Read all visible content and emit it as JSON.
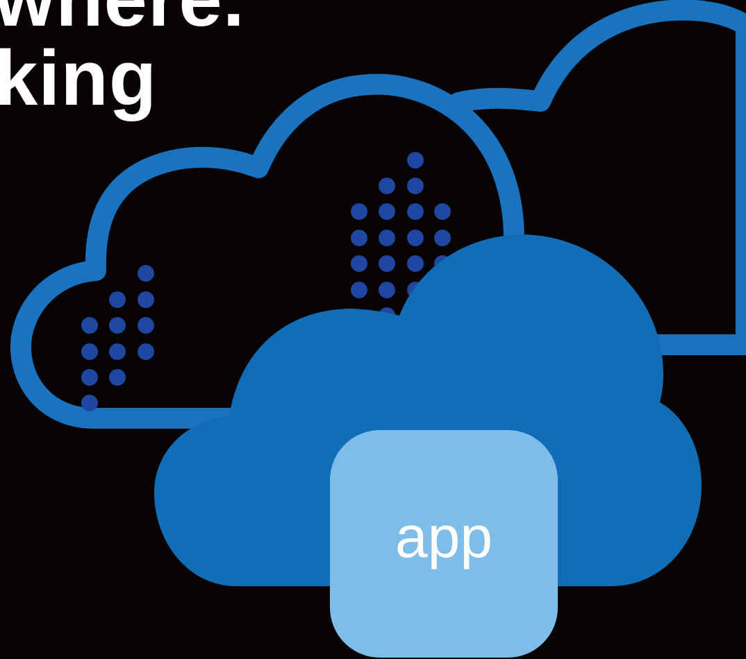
{
  "headline": {
    "line1": "where.",
    "line2": "king"
  },
  "app_tile": {
    "label": "app"
  },
  "icons": {
    "back_cloud": "cloud-outline-icon",
    "mid_cloud": "cloud-outline-icon",
    "front_cloud": "cloud-filled-icon",
    "dots": "dot-pattern"
  },
  "colors": {
    "background": "#070303",
    "cloud_outline": "#1a73bf",
    "cloud_fill": "#126db7",
    "dots": "#1f46a0",
    "app_tile": "#7fbde9",
    "text": "#ffffff"
  }
}
